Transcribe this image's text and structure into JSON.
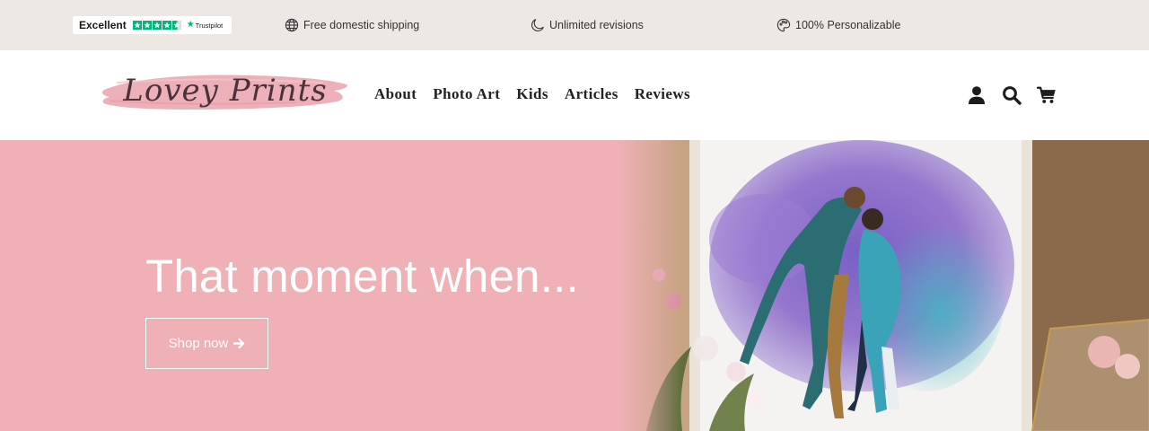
{
  "announcement": {
    "trustpilot": {
      "rating_word": "Excellent",
      "stars": 4.5,
      "brand": "Trustpilot",
      "color": "#00b67a"
    },
    "perks": [
      {
        "icon": "globe-icon",
        "text": "Free domestic shipping"
      },
      {
        "icon": "moon-icon",
        "text": "Unlimited revisions"
      },
      {
        "icon": "palette-icon",
        "text": "100% Personalizable"
      }
    ],
    "background": "#ede8e4"
  },
  "header": {
    "logo_text": "Lovey Prints",
    "nav": [
      "About",
      "Photo Art",
      "Kids",
      "Articles",
      "Reviews"
    ],
    "icons": [
      "account-icon",
      "search-icon",
      "cart-icon"
    ]
  },
  "hero": {
    "title": "That moment when...",
    "cta_label": "Shop now",
    "cta_icon": "arrow-right-icon",
    "background": "#efb0b6",
    "image": "watercolor couple portrait in frame with flowers"
  }
}
